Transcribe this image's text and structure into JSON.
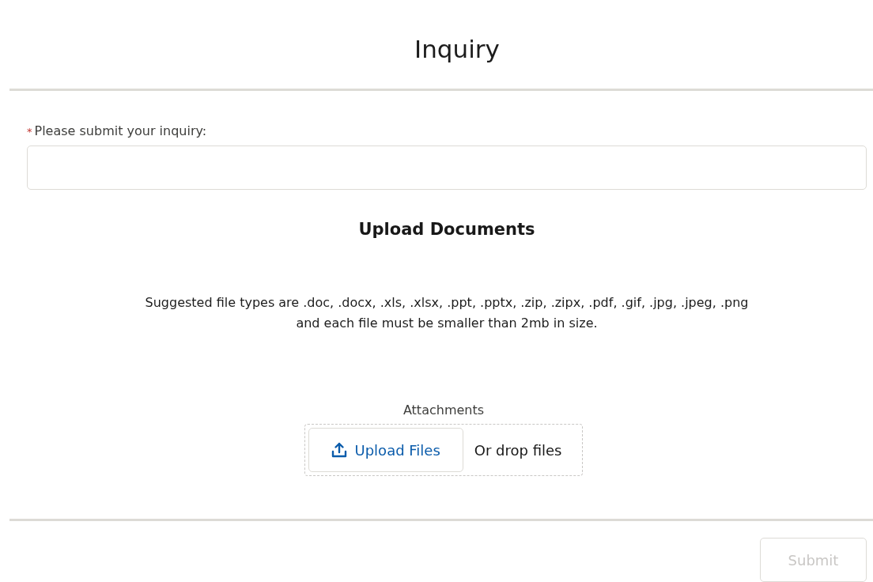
{
  "title": "Inquiry",
  "inquiry": {
    "label": "Please submit your inquiry:",
    "required_mark": "*",
    "required": true
  },
  "upload": {
    "heading": "Upload Documents",
    "description_lines": [
      "Suggested file types are .doc, .docx, .xls, .xlsx, .ppt, .pptx, .zip, .zipx, .pdf, .gif, .jpg, .jpeg, .png",
      "and each file must be smaller than 2mb in size."
    ],
    "attachments_label": "Attachments",
    "button": "Upload Files",
    "drop_text": "Or drop files"
  },
  "submit": {
    "label": "Submit",
    "disabled": true
  }
}
